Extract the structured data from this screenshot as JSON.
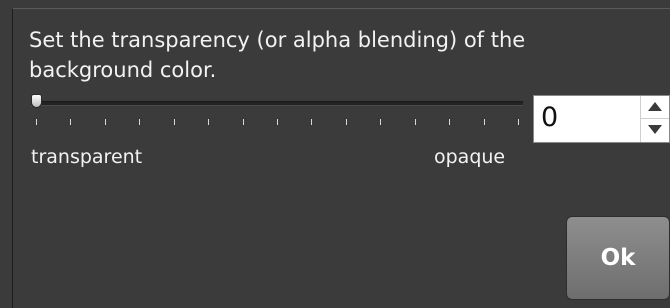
{
  "dialog": {
    "message": "Set the transparency (or alpha blending) of the background color.",
    "slider": {
      "value_fraction": 0,
      "min_label": "transparent",
      "max_label": "opaque",
      "tick_count": 15
    },
    "spinbox": {
      "value": "0",
      "up_icon": "triangle-up-icon",
      "down_icon": "triangle-down-icon"
    },
    "ok_label": "Ok"
  }
}
